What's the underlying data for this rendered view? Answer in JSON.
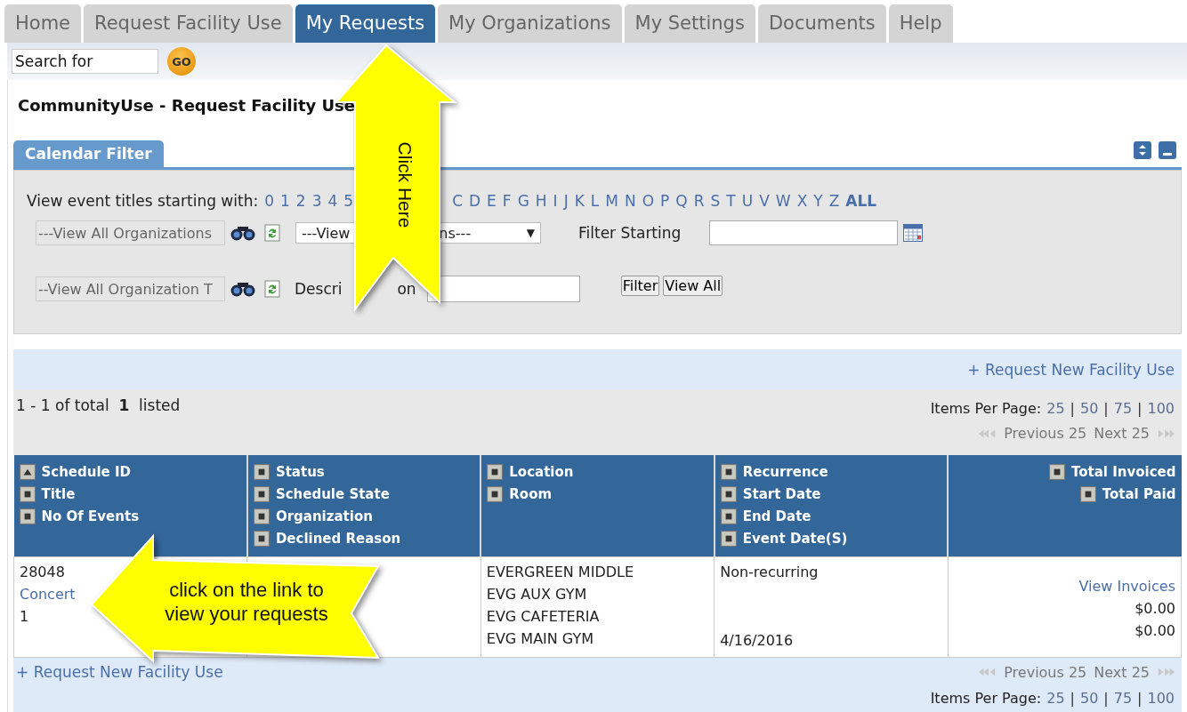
{
  "tabs": [
    {
      "label": "Home",
      "selected": false
    },
    {
      "label": "Request Facility Use",
      "selected": false
    },
    {
      "label": "My Requests",
      "selected": true
    },
    {
      "label": "My Organizations",
      "selected": false
    },
    {
      "label": "My Settings",
      "selected": false
    },
    {
      "label": "Documents",
      "selected": false
    },
    {
      "label": "Help",
      "selected": false
    }
  ],
  "search": {
    "value": "Search for",
    "button": "GO"
  },
  "page_title": "CommunityUse - Request Facility Use",
  "calendar_filter": {
    "title": "Calendar Filter",
    "letters_label": "View event titles starting with:",
    "letters_before": [
      "0",
      "1",
      "2",
      "3",
      "4",
      "5"
    ],
    "letters_after": [
      "C",
      "D",
      "E",
      "F",
      "G",
      "H",
      "I",
      "J",
      "K",
      "L",
      "M",
      "N",
      "O",
      "P",
      "Q",
      "R",
      "S",
      "T",
      "U",
      "V",
      "W",
      "X",
      "Y",
      "Z"
    ],
    "all_link": "ALL",
    "organizations_field": "---View All Organizations",
    "dropdown_parts": [
      "---View",
      "ns---"
    ],
    "dropdown_caret": "▼",
    "filter_starting_label": "Filter Starting",
    "organization_types_field": "--View All Organization T",
    "description_label_parts": [
      "Descri",
      "on"
    ],
    "buttons": [
      "Filter",
      "View All"
    ]
  },
  "request_link_top": {
    "plus": "+",
    "label": "Request New Facility Use"
  },
  "summary": "1 - 1 of total  **1**  listed",
  "items_per_page_top": {
    "label": "Items Per Page:",
    "options": [
      "25",
      "50",
      "75",
      "100"
    ],
    "separator": "|"
  },
  "pager_top": {
    "previous": "Previous 25",
    "next": "Next 25"
  },
  "table": {
    "columns": [
      {
        "kind": "text",
        "fields": [
          {
            "label": "Schedule ID",
            "sorted": true
          },
          {
            "label": "Title",
            "sorted": false
          },
          {
            "label": "No Of Events",
            "sorted": false
          }
        ]
      },
      {
        "kind": "text",
        "fields": [
          {
            "label": "Status",
            "sorted": false
          },
          {
            "label": "Schedule State",
            "sorted": false
          },
          {
            "label": "Organization",
            "sorted": false
          },
          {
            "label": "Declined Reason",
            "sorted": false
          }
        ]
      },
      {
        "kind": "text",
        "fields": [
          {
            "label": "Location",
            "sorted": false
          },
          {
            "label": "Room",
            "sorted": false
          }
        ]
      },
      {
        "kind": "text",
        "fields": [
          {
            "label": "Recurrence",
            "sorted": false
          },
          {
            "label": "Start Date",
            "sorted": false
          },
          {
            "label": "End Date",
            "sorted": false
          },
          {
            "label": "Event Date(S)",
            "sorted": false
          }
        ]
      },
      {
        "kind": "money",
        "fields": [
          {
            "label": "Total Invoiced",
            "sorted": false
          },
          {
            "label": "Total Paid",
            "sorted": false
          }
        ]
      }
    ],
    "rows": [
      {
        "cells": [
          {
            "lines": [
              {
                "text": "28048",
                "kind": "text"
              },
              {
                "text": "Concert",
                "kind": "link"
              },
              {
                "text": "1",
                "kind": "text"
              }
            ]
          },
          {},
          {
            "lines": [
              {
                "text": "EVERGREEN MIDDLE",
                "kind": "text"
              },
              {
                "text": "EVG AUX GYM",
                "kind": "text"
              },
              {
                "text": "EVG CAFETERIA",
                "kind": "text"
              },
              {
                "text": "EVG MAIN GYM",
                "kind": "text"
              }
            ]
          },
          {
            "lines": [
              {
                "text": "Non-recurring",
                "kind": "text"
              },
              {
                "text": "4/16/2016",
                "kind": "bottom"
              }
            ]
          },
          {
            "lines": [
              {
                "text": "View Invoices",
                "kind": "link"
              },
              {
                "text": "$0.00",
                "kind": "text"
              },
              {
                "text": "$0.00",
                "kind": "text"
              }
            ]
          }
        ]
      }
    ]
  },
  "request_link_bottom": {
    "plus": "+",
    "label": "Request New Facility Use"
  },
  "pager_bottom": {
    "previous": "Previous 25",
    "next": "Next 25"
  },
  "items_per_page_bottom": {
    "label": "Items Per Page:",
    "options": [
      "25",
      "50",
      "75",
      "100"
    ],
    "separator": "|"
  },
  "annotations": [
    {
      "kind": "up-arrow",
      "text": "Click Here"
    },
    {
      "kind": "left-arrow",
      "text": "click on the link to view your requests"
    }
  ]
}
